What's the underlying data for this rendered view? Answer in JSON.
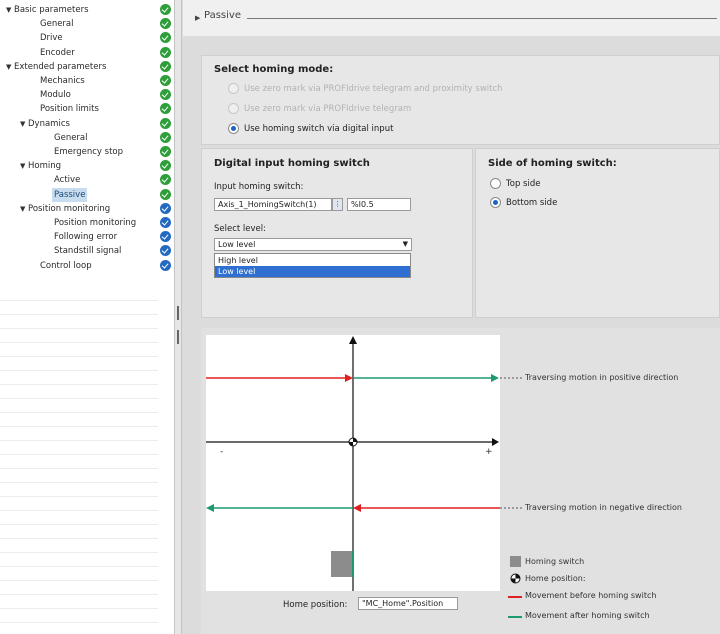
{
  "nav": {
    "items": [
      {
        "label": "Basic parameters",
        "level": 0,
        "expanded": true,
        "status": "green"
      },
      {
        "label": "General",
        "level": 1,
        "status": "green"
      },
      {
        "label": "Drive",
        "level": 1,
        "status": "green"
      },
      {
        "label": "Encoder",
        "level": 1,
        "status": "green"
      },
      {
        "label": "Extended parameters",
        "level": 0,
        "expanded": true,
        "status": "green"
      },
      {
        "label": "Mechanics",
        "level": 1,
        "status": "green"
      },
      {
        "label": "Modulo",
        "level": 1,
        "status": "green"
      },
      {
        "label": "Position limits",
        "level": 1,
        "status": "green"
      },
      {
        "label": "Dynamics",
        "level": 1,
        "expanded": true,
        "status": "green"
      },
      {
        "label": "General",
        "level": 2,
        "status": "green"
      },
      {
        "label": "Emergency stop",
        "level": 2,
        "status": "green"
      },
      {
        "label": "Homing",
        "level": 1,
        "expanded": true,
        "status": "green"
      },
      {
        "label": "Active",
        "level": 2,
        "status": "green"
      },
      {
        "label": "Passive",
        "level": 2,
        "status": "green",
        "selected": true
      },
      {
        "label": "Position monitoring",
        "level": 1,
        "expanded": true,
        "status": "blue"
      },
      {
        "label": "Position monitoring",
        "level": 2,
        "status": "blue"
      },
      {
        "label": "Following error",
        "level": 2,
        "status": "blue"
      },
      {
        "label": "Standstill signal",
        "level": 2,
        "status": "blue"
      },
      {
        "label": "Control loop",
        "level": 1,
        "status": "blue"
      }
    ]
  },
  "section": {
    "title": "Passive"
  },
  "homing_mode": {
    "heading": "Select homing mode:",
    "options": [
      {
        "label": "Use zero mark via PROFIdrive telegram and proximity switch",
        "enabled": false,
        "selected": false
      },
      {
        "label": "Use zero mark via PROFIdrive telegram",
        "enabled": false,
        "selected": false
      },
      {
        "label": "Use homing switch via digital input",
        "enabled": true,
        "selected": true
      }
    ]
  },
  "digital_input": {
    "heading": "Digital input homing switch",
    "input_label": "Input homing switch:",
    "input_value": "Axis_1_HomingSwitch(1)",
    "address_value": "%I0.5",
    "level_label": "Select level:",
    "level_value": "Low level",
    "level_options": [
      "High level",
      "Low level"
    ],
    "level_selected_index": 1
  },
  "side": {
    "heading": "Side of homing switch:",
    "options": [
      {
        "label": "Top side",
        "selected": false
      },
      {
        "label": "Bottom side",
        "selected": true
      }
    ]
  },
  "diagram": {
    "motion_positive": "Traversing motion in positive direction",
    "motion_negative": "Traversing motion in negative direction",
    "axis_minus": "-",
    "axis_plus": "+",
    "home_position_label": "Home position:",
    "home_position_value": "\"MC_Home\".Position",
    "legend": {
      "homing_switch": "Homing switch",
      "home_position": "Home position:",
      "before": "Movement before homing switch",
      "after": "Movement after homing switch"
    },
    "colors": {
      "before": "#e02020",
      "after": "#1e9a73",
      "switch": "#8c8c8c"
    }
  }
}
